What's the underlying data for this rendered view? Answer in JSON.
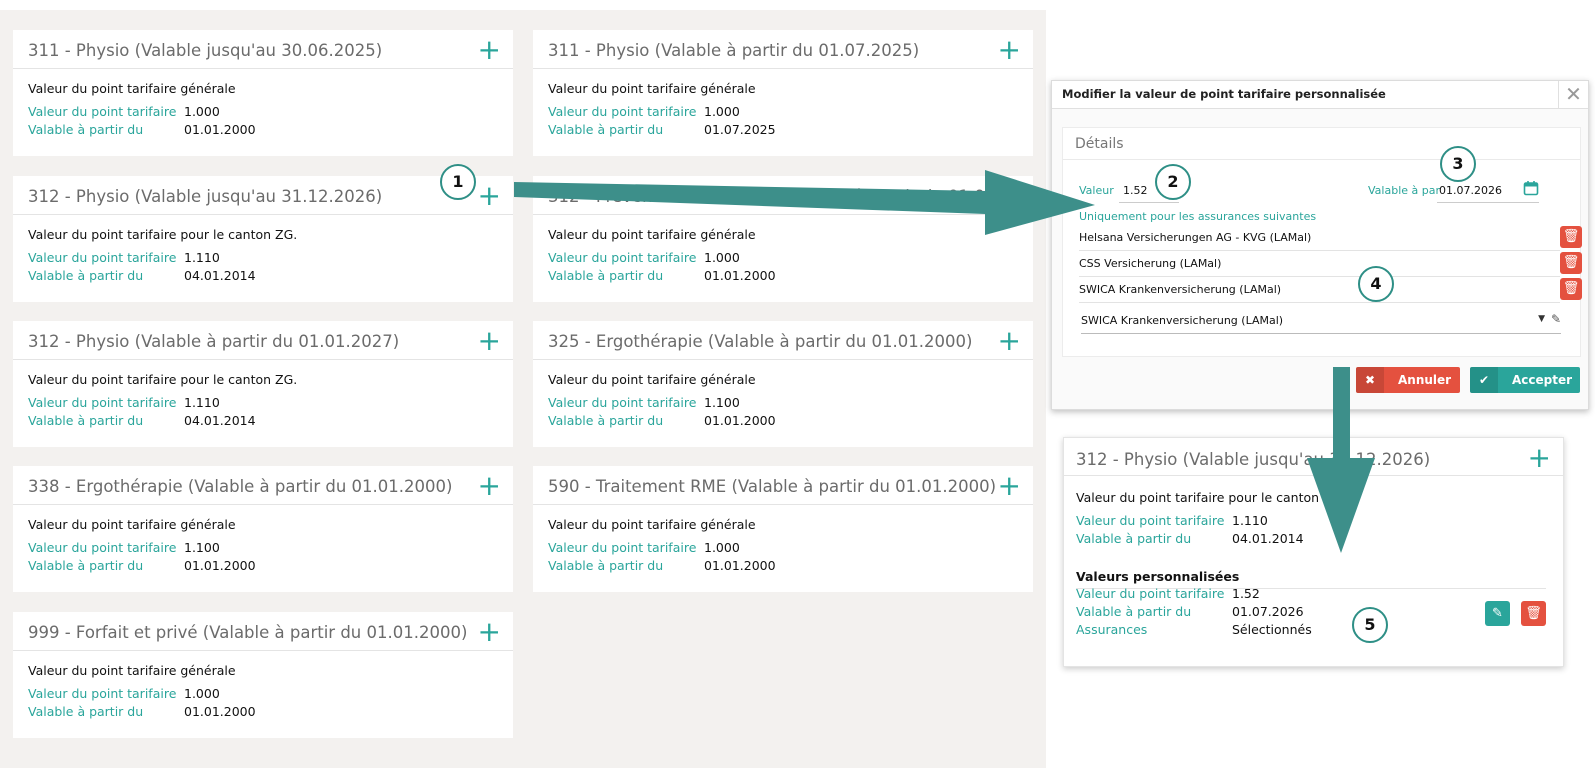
{
  "labels": {
    "point_value": "Valeur du point tarifaire",
    "valid_from": "Valable à partir du",
    "insurances": "Assurances"
  },
  "cards": [
    {
      "title": "311 - Physio (Valable jusqu'au 30.06.2025)",
      "desc": "Valeur du point tarifaire générale",
      "value": "1.000",
      "date": "01.01.2000"
    },
    {
      "title": "311 - Physio (Valable à partir du 01.07.2025)",
      "desc": "Valeur du point tarifaire générale",
      "value": "1.000",
      "date": "01.07.2025"
    },
    {
      "title": "312 - Physio (Valable jusqu'au 31.12.2026)",
      "desc": "Valeur du point tarifaire pour le canton ZG.",
      "value": "1.110",
      "date": "04.01.2014"
    },
    {
      "title": "312 - Prévention des chutes (Valable à partir du 01.01.2000)",
      "desc": "Valeur du point tarifaire générale",
      "value": "1.000",
      "date": "01.01.2000"
    },
    {
      "title": "312 - Physio (Valable à partir du 01.01.2027)",
      "desc": "Valeur du point tarifaire pour le canton ZG.",
      "value": "1.110",
      "date": "04.01.2014"
    },
    {
      "title": "325 - Ergothérapie (Valable à partir du 01.01.2000)",
      "desc": "Valeur du point tarifaire générale",
      "value": "1.100",
      "date": "01.01.2000"
    },
    {
      "title": "338 - Ergothérapie (Valable à partir du 01.01.2000)",
      "desc": "Valeur du point tarifaire générale",
      "value": "1.100",
      "date": "01.01.2000"
    },
    {
      "title": "590 - Traitement RME (Valable à partir du 01.01.2000)",
      "desc": "Valeur du point tarifaire générale",
      "value": "1.000",
      "date": "01.01.2000"
    },
    {
      "title": "999 - Forfait et privé (Valable à partir du 01.01.2000)",
      "desc": "Valeur du point tarifaire générale",
      "value": "1.000",
      "date": "01.01.2000"
    }
  ],
  "dialog": {
    "title": "Modifier la valeur de point tarifaire personnalisée",
    "panel_title": "Détails",
    "value_label": "Valeur",
    "value": "1.52",
    "valid_from_label": "Valable à partir du",
    "valid_from": "01.07.2026",
    "insurances_label": "Uniquement pour les assurances suivantes",
    "insurances": [
      "Helsana Versicherungen AG - KVG (LAMal)",
      "CSS Versicherung (LAMal)",
      "SWICA Krankenversicherung (LAMal)"
    ],
    "select_value": "SWICA Krankenversicherung (LAMal)",
    "cancel_label": "Annuler",
    "accept_label": "Accepter"
  },
  "result_card": {
    "title": "312 - Physio (Valable jusqu'au 31.12.2026)",
    "desc": "Valeur du point tarifaire pour le canton ZG.",
    "value": "1.110",
    "date": "04.01.2014",
    "custom_title": "Valeurs personnalisées",
    "custom_value": "1.52",
    "custom_date": "01.07.2026",
    "custom_insurances": "Sélectionnés"
  },
  "callouts": [
    "1",
    "2",
    "3",
    "4",
    "5"
  ],
  "icons": {
    "plus": "plus-icon",
    "close": "close-icon",
    "calendar": "calendar-icon",
    "trash": "trash-icon",
    "pencil": "pencil-icon",
    "caret": "caret-down-icon",
    "check": "check-icon",
    "x": "x-icon"
  },
  "colors": {
    "accent": "#2aa59b",
    "danger": "#e4513f",
    "arrow": "#3d8f8a",
    "background": "#f3f1ef"
  }
}
